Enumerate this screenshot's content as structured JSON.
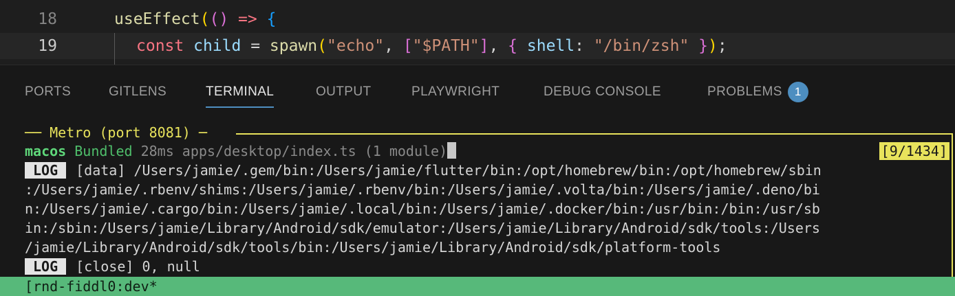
{
  "editor": {
    "lines": [
      {
        "number": "18"
      },
      {
        "number": "19"
      }
    ],
    "line18": {
      "fn": "useEffect",
      "open": "(",
      "parens": "()",
      "arrow": " => ",
      "brace": "{"
    },
    "line19": {
      "kw": "const",
      "var": "child",
      "eq": " = ",
      "fn": "spawn",
      "p_open": "(",
      "str1": "\"echo\"",
      "comma1": ", ",
      "br_open": "[",
      "str2": "\"$PATH\"",
      "br_close": "]",
      "comma2": ", ",
      "obj_open": "{ ",
      "key": "shell",
      "colon": ": ",
      "str3": "\"/bin/zsh\"",
      "obj_close": " }",
      "p_close": ")",
      "semi": ";"
    }
  },
  "panel": {
    "tabs": [
      {
        "label": "PORTS"
      },
      {
        "label": "GITLENS"
      },
      {
        "label": "TERMINAL",
        "active": true
      },
      {
        "label": "OUTPUT"
      },
      {
        "label": "PLAYWRIGHT"
      },
      {
        "label": "DEBUG CONSOLE"
      },
      {
        "label": "PROBLEMS",
        "badge": "1"
      }
    ]
  },
  "terminal": {
    "metro_title": "── Metro (port 8081) ─",
    "bundle": {
      "platform": "macos",
      "status": "Bundled",
      "detail": " 28ms apps/desktop/index.ts (1 module)"
    },
    "counter": "[9/1434]",
    "log1": {
      "badge": "LOG",
      "lines": [
        "[data] /Users/jamie/.gem/bin:/Users/jamie/flutter/bin:/opt/homebrew/bin:/opt/homebrew/sbin",
        ":/Users/jamie/.rbenv/shims:/Users/jamie/.rbenv/bin:/Users/jamie/.volta/bin:/Users/jamie/.deno/bi",
        "n:/Users/jamie/.cargo/bin:/Users/jamie/.local/bin:/Users/jamie/.docker/bin:/usr/bin:/bin:/usr/sb",
        "in:/sbin:/Users/jamie/Library/Android/sdk/emulator:/Users/jamie/Library/Android/sdk/tools:/Users",
        "/jamie/Library/Android/sdk/tools/bin:/Users/jamie/Library/Android/sdk/platform-tools"
      ]
    },
    "log2": {
      "badge": "LOG",
      "text": "[close] 0, null"
    },
    "statusbar": "[rnd-fiddl0:dev*",
    "colors": {
      "metro": "#e8e35c",
      "statusbar": "#57b97a",
      "accent_tab": "#4f8fc2"
    }
  }
}
